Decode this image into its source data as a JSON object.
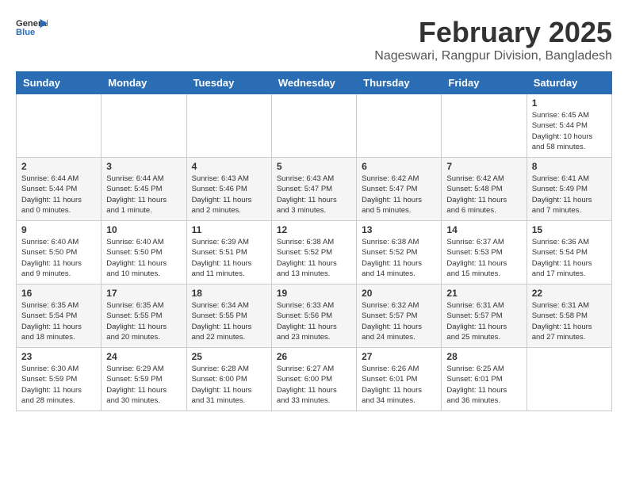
{
  "logo": {
    "general": "General",
    "blue": "Blue"
  },
  "header": {
    "title": "February 2025",
    "subtitle": "Nageswari, Rangpur Division, Bangladesh"
  },
  "weekdays": [
    "Sunday",
    "Monday",
    "Tuesday",
    "Wednesday",
    "Thursday",
    "Friday",
    "Saturday"
  ],
  "weeks": [
    [
      {
        "day": "",
        "info": ""
      },
      {
        "day": "",
        "info": ""
      },
      {
        "day": "",
        "info": ""
      },
      {
        "day": "",
        "info": ""
      },
      {
        "day": "",
        "info": ""
      },
      {
        "day": "",
        "info": ""
      },
      {
        "day": "1",
        "info": "Sunrise: 6:45 AM\nSunset: 5:44 PM\nDaylight: 10 hours\nand 58 minutes."
      }
    ],
    [
      {
        "day": "2",
        "info": "Sunrise: 6:44 AM\nSunset: 5:44 PM\nDaylight: 11 hours\nand 0 minutes."
      },
      {
        "day": "3",
        "info": "Sunrise: 6:44 AM\nSunset: 5:45 PM\nDaylight: 11 hours\nand 1 minute."
      },
      {
        "day": "4",
        "info": "Sunrise: 6:43 AM\nSunset: 5:46 PM\nDaylight: 11 hours\nand 2 minutes."
      },
      {
        "day": "5",
        "info": "Sunrise: 6:43 AM\nSunset: 5:47 PM\nDaylight: 11 hours\nand 3 minutes."
      },
      {
        "day": "6",
        "info": "Sunrise: 6:42 AM\nSunset: 5:47 PM\nDaylight: 11 hours\nand 5 minutes."
      },
      {
        "day": "7",
        "info": "Sunrise: 6:42 AM\nSunset: 5:48 PM\nDaylight: 11 hours\nand 6 minutes."
      },
      {
        "day": "8",
        "info": "Sunrise: 6:41 AM\nSunset: 5:49 PM\nDaylight: 11 hours\nand 7 minutes."
      }
    ],
    [
      {
        "day": "9",
        "info": "Sunrise: 6:40 AM\nSunset: 5:50 PM\nDaylight: 11 hours\nand 9 minutes."
      },
      {
        "day": "10",
        "info": "Sunrise: 6:40 AM\nSunset: 5:50 PM\nDaylight: 11 hours\nand 10 minutes."
      },
      {
        "day": "11",
        "info": "Sunrise: 6:39 AM\nSunset: 5:51 PM\nDaylight: 11 hours\nand 11 minutes."
      },
      {
        "day": "12",
        "info": "Sunrise: 6:38 AM\nSunset: 5:52 PM\nDaylight: 11 hours\nand 13 minutes."
      },
      {
        "day": "13",
        "info": "Sunrise: 6:38 AM\nSunset: 5:52 PM\nDaylight: 11 hours\nand 14 minutes."
      },
      {
        "day": "14",
        "info": "Sunrise: 6:37 AM\nSunset: 5:53 PM\nDaylight: 11 hours\nand 15 minutes."
      },
      {
        "day": "15",
        "info": "Sunrise: 6:36 AM\nSunset: 5:54 PM\nDaylight: 11 hours\nand 17 minutes."
      }
    ],
    [
      {
        "day": "16",
        "info": "Sunrise: 6:35 AM\nSunset: 5:54 PM\nDaylight: 11 hours\nand 18 minutes."
      },
      {
        "day": "17",
        "info": "Sunrise: 6:35 AM\nSunset: 5:55 PM\nDaylight: 11 hours\nand 20 minutes."
      },
      {
        "day": "18",
        "info": "Sunrise: 6:34 AM\nSunset: 5:55 PM\nDaylight: 11 hours\nand 22 minutes."
      },
      {
        "day": "19",
        "info": "Sunrise: 6:33 AM\nSunset: 5:56 PM\nDaylight: 11 hours\nand 23 minutes."
      },
      {
        "day": "20",
        "info": "Sunrise: 6:32 AM\nSunset: 5:57 PM\nDaylight: 11 hours\nand 24 minutes."
      },
      {
        "day": "21",
        "info": "Sunrise: 6:31 AM\nSunset: 5:57 PM\nDaylight: 11 hours\nand 25 minutes."
      },
      {
        "day": "22",
        "info": "Sunrise: 6:31 AM\nSunset: 5:58 PM\nDaylight: 11 hours\nand 27 minutes."
      }
    ],
    [
      {
        "day": "23",
        "info": "Sunrise: 6:30 AM\nSunset: 5:59 PM\nDaylight: 11 hours\nand 28 minutes."
      },
      {
        "day": "24",
        "info": "Sunrise: 6:29 AM\nSunset: 5:59 PM\nDaylight: 11 hours\nand 30 minutes."
      },
      {
        "day": "25",
        "info": "Sunrise: 6:28 AM\nSunset: 6:00 PM\nDaylight: 11 hours\nand 31 minutes."
      },
      {
        "day": "26",
        "info": "Sunrise: 6:27 AM\nSunset: 6:00 PM\nDaylight: 11 hours\nand 33 minutes."
      },
      {
        "day": "27",
        "info": "Sunrise: 6:26 AM\nSunset: 6:01 PM\nDaylight: 11 hours\nand 34 minutes."
      },
      {
        "day": "28",
        "info": "Sunrise: 6:25 AM\nSunset: 6:01 PM\nDaylight: 11 hours\nand 36 minutes."
      },
      {
        "day": "",
        "info": ""
      }
    ]
  ]
}
